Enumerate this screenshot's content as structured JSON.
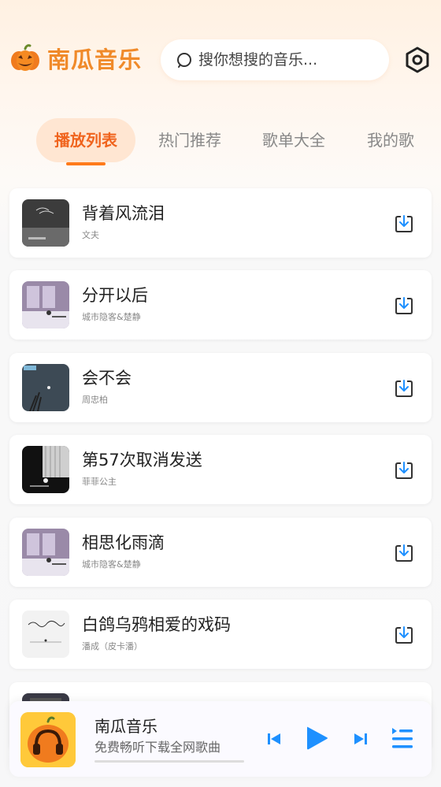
{
  "header": {
    "app_title": "南瓜音乐",
    "search_placeholder": "搜你想搜的音乐...",
    "logo_icon": "pumpkin-icon",
    "settings_icon": "settings-hexagon-icon"
  },
  "tabs": [
    {
      "label": "播放列表",
      "active": true
    },
    {
      "label": "热门推荐",
      "active": false
    },
    {
      "label": "歌单大全",
      "active": false
    },
    {
      "label": "我的歌",
      "active": false
    }
  ],
  "songs": [
    {
      "title": "背着风流泪",
      "artist": "文夫"
    },
    {
      "title": "分开以后",
      "artist": "城市隐客&楚静"
    },
    {
      "title": "会不会",
      "artist": "周忠柏"
    },
    {
      "title": "第57次取消发送",
      "artist": "菲菲公主"
    },
    {
      "title": "相思化雨滴",
      "artist": "城市隐客&楚静"
    },
    {
      "title": "白鸽乌鸦相爱的戏码",
      "artist": "潘成（皮卡潘）"
    }
  ],
  "player": {
    "title": "南瓜音乐",
    "subtitle": "免费畅听下载全网歌曲",
    "progress": 0.0
  },
  "colors": {
    "accent": "#f0641e",
    "brand": "#f08a2a",
    "control_blue": "#1e90ff"
  }
}
